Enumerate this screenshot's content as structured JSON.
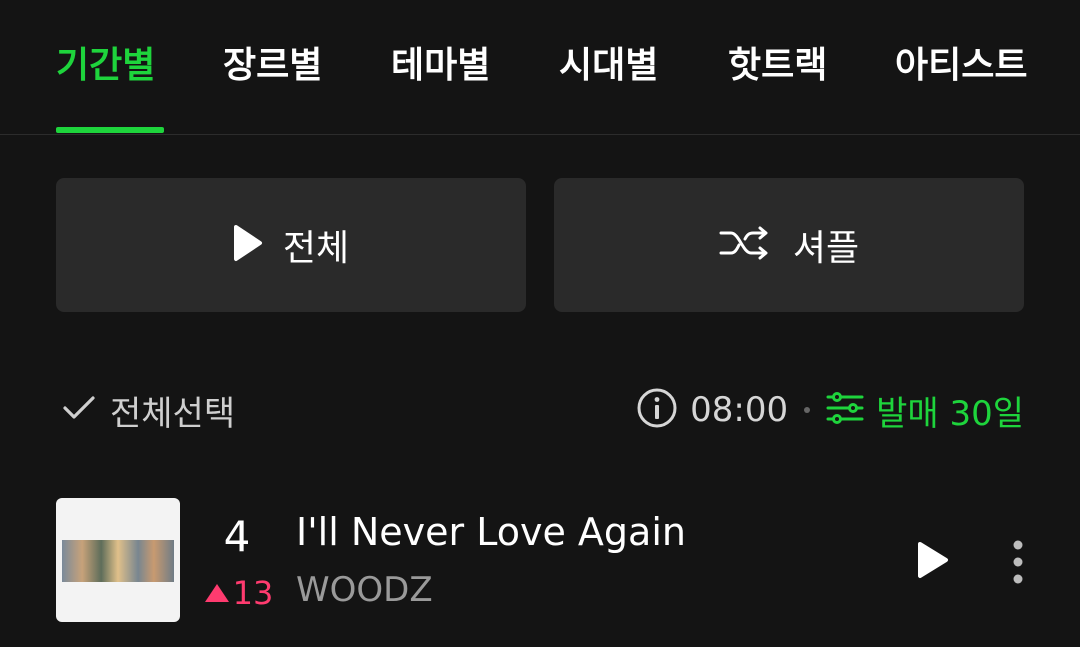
{
  "tabs": [
    {
      "label": "기간별",
      "active": true
    },
    {
      "label": "장르별",
      "active": false
    },
    {
      "label": "테마별",
      "active": false
    },
    {
      "label": "시대별",
      "active": false
    },
    {
      "label": "핫트랙",
      "active": false
    },
    {
      "label": "아티스트",
      "active": false
    }
  ],
  "actions": {
    "play_all_label": "전체",
    "shuffle_label": "셔플"
  },
  "selection": {
    "select_all_label": "전체선택",
    "time": "08:00",
    "filter_label": "발매 30일"
  },
  "track": {
    "rank": "4",
    "rank_change": "13",
    "title": "I'll Never Love Again",
    "artist": "WOODZ"
  },
  "colors": {
    "accent": "#1ed43c",
    "rank_up": "#ff3b6f",
    "background": "#141414"
  },
  "icons": {
    "play": "play-icon",
    "shuffle": "shuffle-icon",
    "check": "check-icon",
    "info": "info-icon",
    "filter": "filter-icon",
    "more": "more-vertical-icon"
  }
}
